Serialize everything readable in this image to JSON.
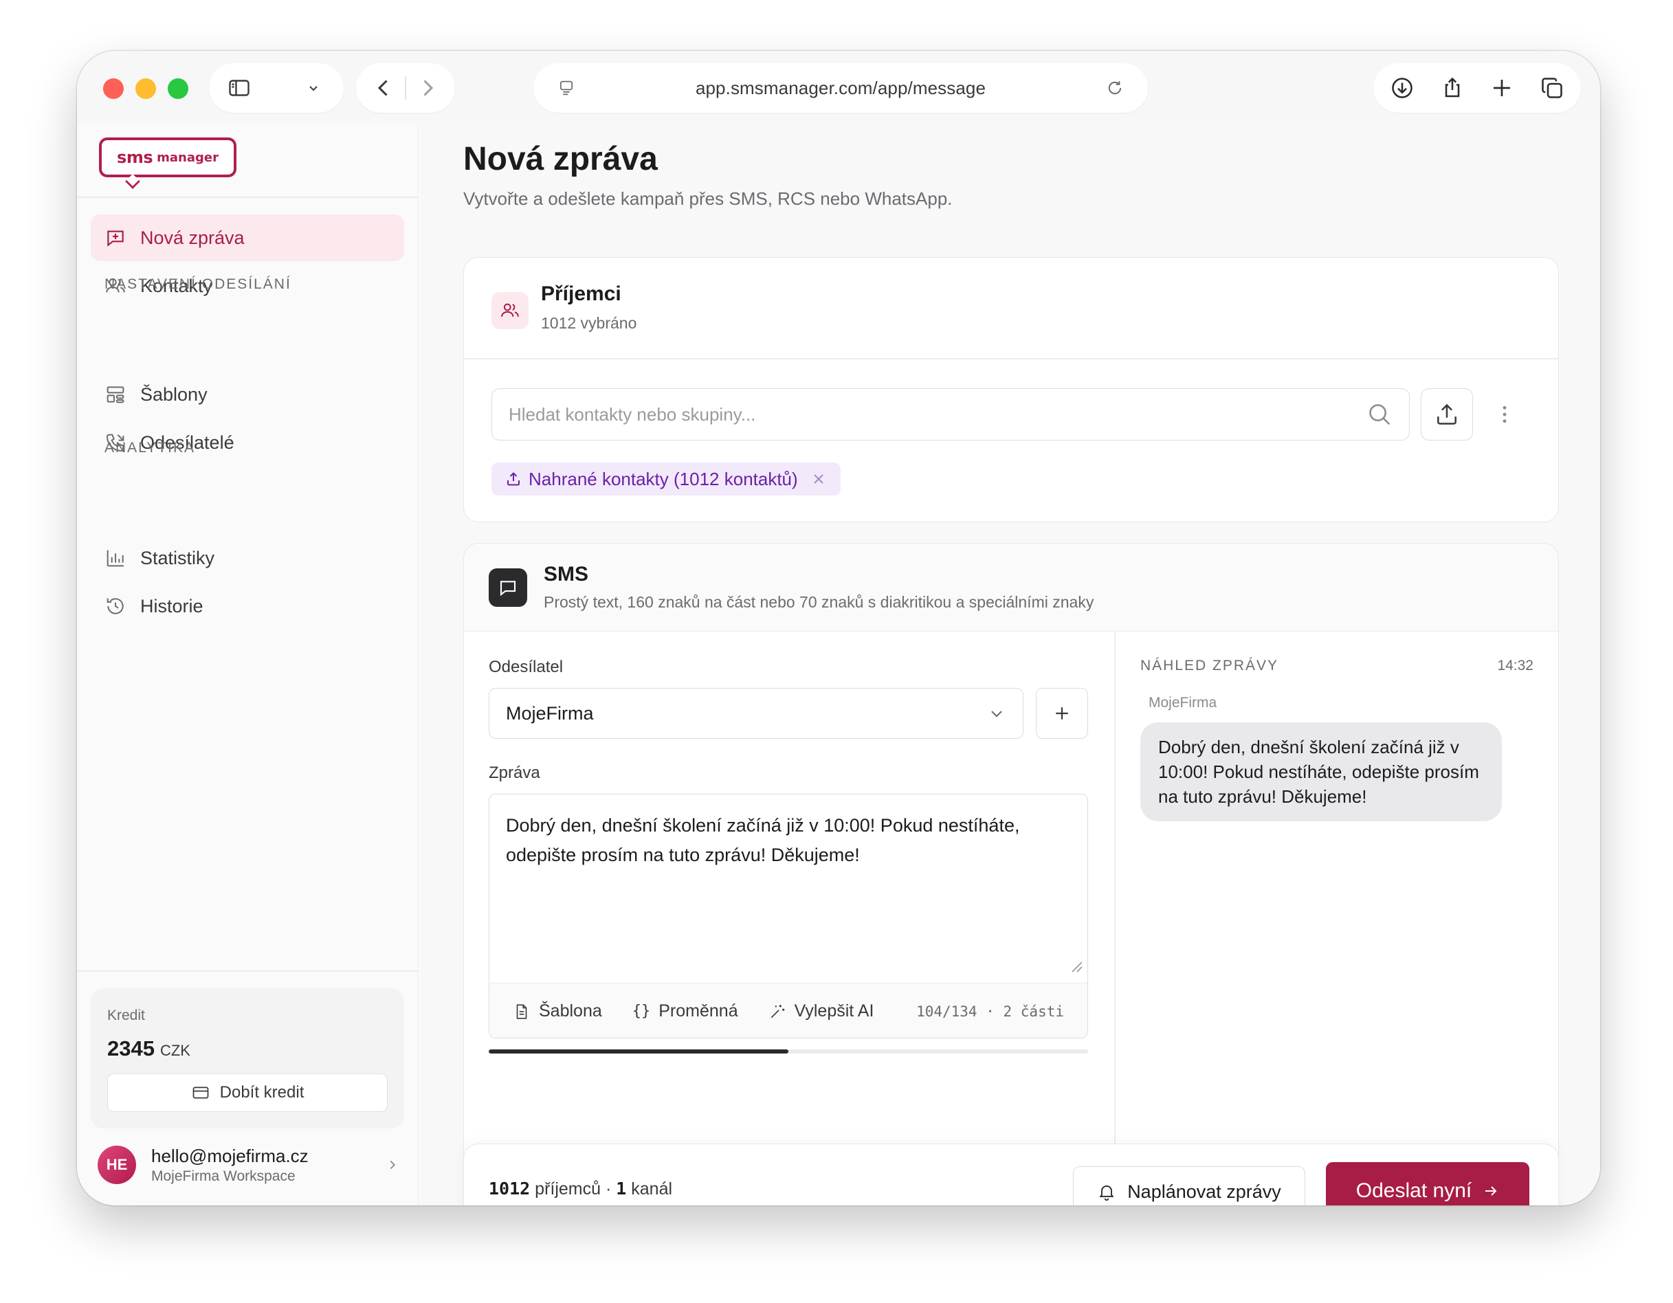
{
  "browser": {
    "url": "app.smsmanager.com/app/message",
    "icons": [
      "sidebar-icon",
      "chevron-down-icon",
      "back-icon",
      "forward-icon",
      "page-icon",
      "reload-icon",
      "download-icon",
      "share-icon",
      "plus-icon",
      "tabs-icon"
    ]
  },
  "sidebar": {
    "logo": {
      "sms": "sms",
      "manager": "manager"
    },
    "items": [
      {
        "label": "Nová zpráva",
        "icon": "message-plus-icon",
        "active": true
      },
      {
        "label": "Kontakty",
        "icon": "users-icon",
        "active": false
      }
    ],
    "sections": [
      {
        "title": "NASTAVENÍ ODESÍLÁNÍ",
        "items": [
          {
            "label": "Šablony",
            "icon": "template-icon"
          },
          {
            "label": "Odesílatelé",
            "icon": "phone-icon"
          }
        ]
      },
      {
        "title": "ANALYTIKA",
        "items": [
          {
            "label": "Statistiky",
            "icon": "bar-chart-icon"
          },
          {
            "label": "Historie",
            "icon": "history-icon"
          }
        ]
      }
    ],
    "credit": {
      "label": "Kredit",
      "value": "2345",
      "currency": "CZK",
      "topup_label": "Dobít kredit"
    },
    "user": {
      "initials": "HE",
      "email": "hello@mojefirma.cz",
      "workspace": "MojeFirma Workspace"
    }
  },
  "main": {
    "title": "Nová zpráva",
    "subtitle": "Vytvořte a odešlete kampaň přes SMS, RCS nebo WhatsApp.",
    "recipients": {
      "title": "Příjemci",
      "subtitle": "1012 vybráno",
      "search_placeholder": "Hledat kontakty nebo skupiny...",
      "chip_label": "Nahrané kontakty (1012 kontaktů)"
    },
    "sms": {
      "title": "SMS",
      "subtitle": "Prostý text, 160 znaků na část nebo 70 znaků s diakritikou a speciálními znaky",
      "sender_label": "Odesílatel",
      "sender_value": "MojeFirma",
      "message_label": "Zpráva",
      "message_text": "Dobrý den, dnešní školení začíná již v 10:00! Pokud nestíháte, odepište prosím na tuto zprávu! Děkujeme!",
      "tool_template": "Šablona",
      "tool_variable_brace": "{}",
      "tool_variable": "Proměnná",
      "tool_ai": "Vylepšit AI",
      "counter": "104/134 · 2 části",
      "progress_fraction": 0.5,
      "preview_label": "NÁHLED ZPRÁVY",
      "preview_time": "14:32",
      "preview_sender": "MojeFirma",
      "preview_text": "Dobrý den, dnešní školení začíná již v 10:00! Pokud nestíháte, odepište prosím na tuto zprávu! Děkujeme!"
    },
    "footer": {
      "recipients_count": "1012",
      "recipients_text": "příjemců ·",
      "channels_count": "1",
      "channels_text": "kanál",
      "schedule_label": "Naplánovat zprávy",
      "send_label": "Odeslat nyní"
    }
  },
  "colors": {
    "brand": "#a81d45",
    "brand_light": "#fbe9ee",
    "chip_bg": "#f2e9fb",
    "chip_text": "#6a21a6"
  }
}
